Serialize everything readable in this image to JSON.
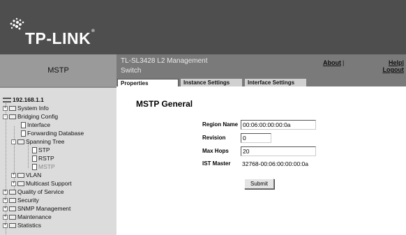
{
  "brand": {
    "logo_text": "TP-LINK",
    "trademark": "®"
  },
  "left_header": {
    "title": "MSTP"
  },
  "header": {
    "switch_title": "TL-SL3428 L2 Management Switch",
    "about_label": "About",
    "about_separator": "|",
    "help_label": "Help",
    "help_separator": "|",
    "logout_label": "Logout"
  },
  "tabs": [
    {
      "label": "Properties",
      "active": true
    },
    {
      "label": "Instance Settings",
      "active": false
    },
    {
      "label": "Interface Settings",
      "active": false
    }
  ],
  "tree": {
    "root": "192.168.1.1",
    "system_info": "System Info",
    "bridging_config": "Bridging Config",
    "interface": "Interface",
    "forwarding_database": "Forwarding Database",
    "spanning_tree": "Spanning Tree",
    "stp": "STP",
    "rstp": "RSTP",
    "mstp": "MSTP",
    "vlan": "VLAN",
    "multicast_support": "Multicast Support",
    "qos": "Quality of Service",
    "security": "Security",
    "snmp": "SNMP Management",
    "maintenance": "Maintenance",
    "statistics": "Statistics",
    "expand_symbol": "+",
    "collapse_symbol": "-"
  },
  "form": {
    "heading": "MSTP General",
    "region_name_label": "Region Name",
    "region_name_value": "00:06:00:00:00:0a",
    "revision_label": "Revision",
    "revision_value": "0",
    "max_hops_label": "Max Hops",
    "max_hops_value": "20",
    "ist_master_label": "IST Master",
    "ist_master_value": "32768-00:06:00:00:00:0a",
    "submit_label": "Submit"
  }
}
